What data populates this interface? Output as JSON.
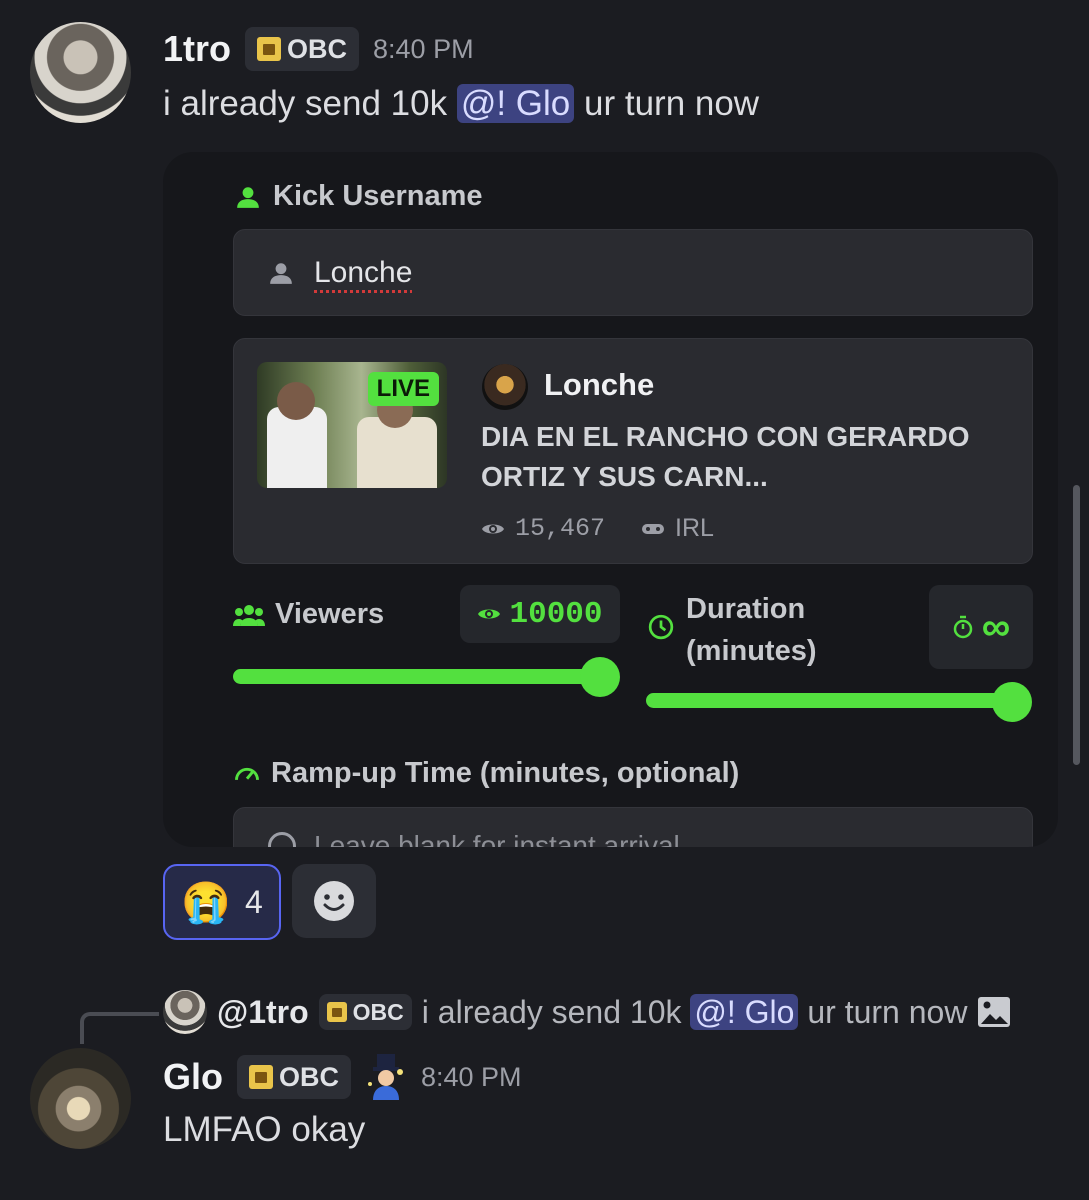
{
  "message1": {
    "username": "1tro",
    "badge": "OBC",
    "time": "8:40 PM",
    "text_before": "i already send 10k",
    "mention": "@! Glo",
    "text_after": "ur turn now"
  },
  "embed": {
    "kick_username_label": "Kick Username",
    "username_value": "Lonche",
    "stream": {
      "live_badge": "LIVE",
      "channel": "Lonche",
      "title_line1": "DIA EN EL RANCHO CON GERARDO",
      "title_line2": "ORTIZ Y SUS CARN...",
      "viewers": "15,467",
      "category": "IRL"
    },
    "viewers_label": "Viewers",
    "viewers_value": "10000",
    "viewers_slider_fraction": 1.0,
    "duration_label_line1": "Duration",
    "duration_label_line2": "(minutes)",
    "duration_value": "∞",
    "duration_slider_fraction": 1.0,
    "rampup_label": "Ramp-up Time (minutes, optional)",
    "rampup_placeholder": "Leave blank for instant arrival"
  },
  "reactions": {
    "emoji": "😭",
    "count": "4",
    "add_reaction_icon": "smile-icon"
  },
  "message2": {
    "reply": {
      "username": "@1tro",
      "badge": "OBC",
      "text_before": "i already send 10k",
      "mention": "@! Glo",
      "text_after": "ur turn now"
    },
    "username": "Glo",
    "badge": "OBC",
    "time": "8:40 PM",
    "text": "LMFAO okay"
  },
  "colors": {
    "accent_green": "#53e03f",
    "mention_bg": "#3d4381",
    "background": "#1b1c21"
  }
}
